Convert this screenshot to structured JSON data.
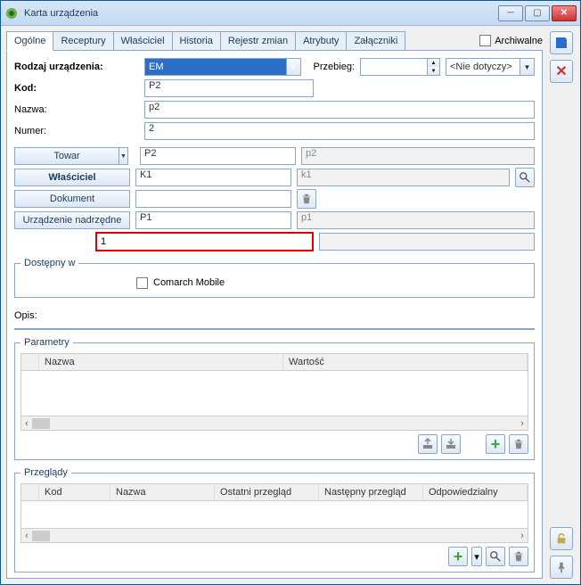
{
  "window": {
    "title": "Karta urządzenia"
  },
  "archive": {
    "label": "Archiwalne"
  },
  "tabs": [
    "Ogólne",
    "Receptury",
    "Właściciel",
    "Historia",
    "Rejestr zmian",
    "Atrybuty",
    "Załączniki"
  ],
  "fields": {
    "rodzaj": {
      "label": "Rodzaj urządzenia:",
      "value": "EM"
    },
    "przebieg": {
      "label": "Przebieg:",
      "value": "",
      "unit": "<Nie dotyczy>"
    },
    "kod": {
      "label": "Kod:",
      "value": "P2"
    },
    "nazwa": {
      "label": "Nazwa:",
      "value": "p2"
    },
    "numer": {
      "label": "Numer:",
      "value": "2"
    },
    "towar": {
      "btn": "Towar",
      "code": "P2",
      "name": "p2"
    },
    "wlasciciel": {
      "btn": "Właściciel",
      "code": "K1",
      "name": "k1"
    },
    "dokument": {
      "btn": "Dokument",
      "value": ""
    },
    "nadrzedne": {
      "btn": "Urządzenie nadrzędne",
      "code": "P1",
      "name": "p1"
    },
    "highlight": "1",
    "dostepny": {
      "legend": "Dostępny w",
      "comarch": "Comarch Mobile"
    },
    "opis": {
      "label": "Opis:"
    }
  },
  "param": {
    "legend": "Parametry",
    "cols": [
      "Nazwa",
      "Wartość"
    ]
  },
  "przeg": {
    "legend": "Przeglądy",
    "cols": [
      "Kod",
      "Nazwa",
      "Ostatni przegląd",
      "Następny przegląd",
      "Odpowiedzialny"
    ]
  }
}
